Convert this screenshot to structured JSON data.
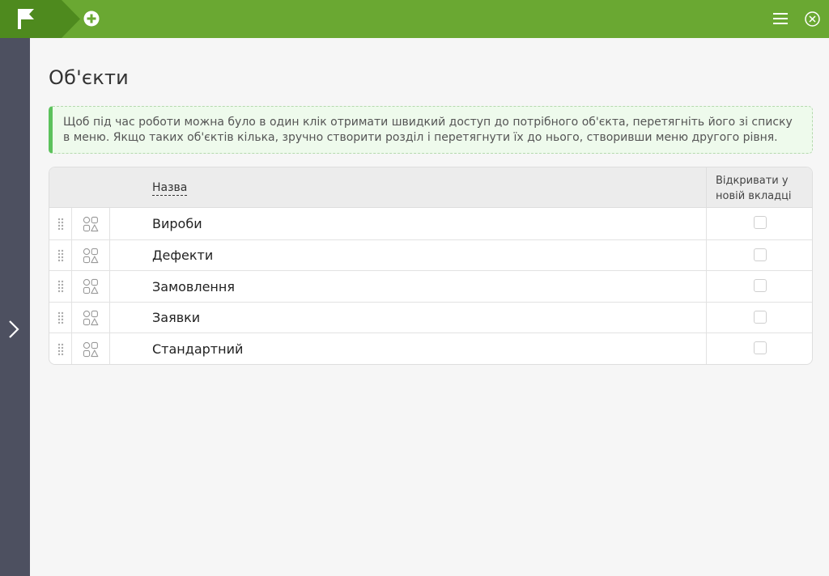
{
  "header": {
    "logo": "flag-logo-icon",
    "add": "plus-circle-icon",
    "menu": "hamburger-menu-icon",
    "close": "close-circle-icon",
    "bg_color": "#6aa832"
  },
  "sidebar": {
    "expand_icon": "chevron-right-icon",
    "bg_color": "#4d5060"
  },
  "page": {
    "title": "Об'єкти",
    "hint": "Щоб під час роботи можна було в один клік отримати швидкий доступ до потрібного об'єкта, перетягніть його зі списку в меню. Якщо таких об'єктів кілька, зручно створити розділ і перетягнути їх до нього, створивши меню другого рівня."
  },
  "table": {
    "columns": {
      "name": "Назва",
      "open_new_tab": "Відкривати у новій вкладці"
    },
    "rows": [
      {
        "name": "Вироби",
        "open_new_tab": false
      },
      {
        "name": "Дефекти",
        "open_new_tab": false
      },
      {
        "name": "Замовлення",
        "open_new_tab": false
      },
      {
        "name": "Заявки",
        "open_new_tab": false
      },
      {
        "name": "Стандартний",
        "open_new_tab": false
      }
    ]
  }
}
